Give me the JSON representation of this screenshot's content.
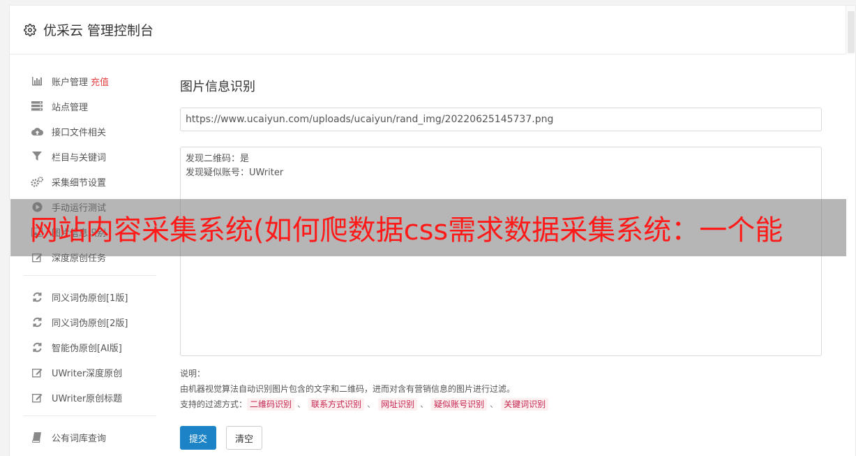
{
  "header": {
    "title": "优采云 管理控制台"
  },
  "sidebar": {
    "items": [
      {
        "label": "账户管理",
        "extra": "充值",
        "icon": "bar-chart-icon"
      },
      {
        "label": "站点管理",
        "icon": "server-icon"
      },
      {
        "label": "接口文件相关",
        "icon": "cloud-upload-icon"
      },
      {
        "label": "栏目与关键词",
        "icon": "filter-icon"
      },
      {
        "label": "采集细节设置",
        "icon": "gears-icon"
      },
      {
        "label": "手动运行测试",
        "icon": "play-icon"
      },
      {
        "label": "图片信息识别",
        "icon": "picture-icon"
      },
      {
        "label": "深度原创任务",
        "icon": "edit-icon"
      }
    ],
    "items2": [
      {
        "label": "同义词伪原创[1版]",
        "icon": "refresh-icon"
      },
      {
        "label": "同义词伪原创[2版]",
        "icon": "refresh-icon"
      },
      {
        "label": "智能伪原创[AI版]",
        "icon": "refresh-icon"
      },
      {
        "label": "UWriter深度原创",
        "icon": "edit-icon"
      },
      {
        "label": "UWriter原创标题",
        "icon": "edit-icon"
      }
    ],
    "items3": [
      {
        "label": "公有词库查询",
        "icon": "book-icon"
      }
    ]
  },
  "main": {
    "title": "图片信息识别",
    "url_value": "https://www.ucaiyun.com/uploads/ucaiyun/rand_img/20220625145737.png",
    "result_lines": [
      "发现二维码：是",
      "发现疑似账号：UWriter"
    ],
    "desc_label": "说明：",
    "desc_text": "由机器视觉算法自动识别图片包含的文字和二维码，进而对含有营销信息的图片进行过滤。",
    "filters_label": "支持的过滤方式：",
    "filters": [
      "二维码识别",
      "联系方式识别",
      "网址识别",
      "疑似账号识别",
      "关键词识别"
    ],
    "separator": "、",
    "submit_label": "提交",
    "clear_label": "清空"
  },
  "overlay": {
    "text": "网站内容采集系统(如何爬数据css需求数据采集系统：一个能"
  },
  "colors": {
    "accent": "#1c84c6",
    "danger": "#e64340",
    "tag_text": "#c7254e",
    "overlay_text": "#ff1a1a"
  }
}
